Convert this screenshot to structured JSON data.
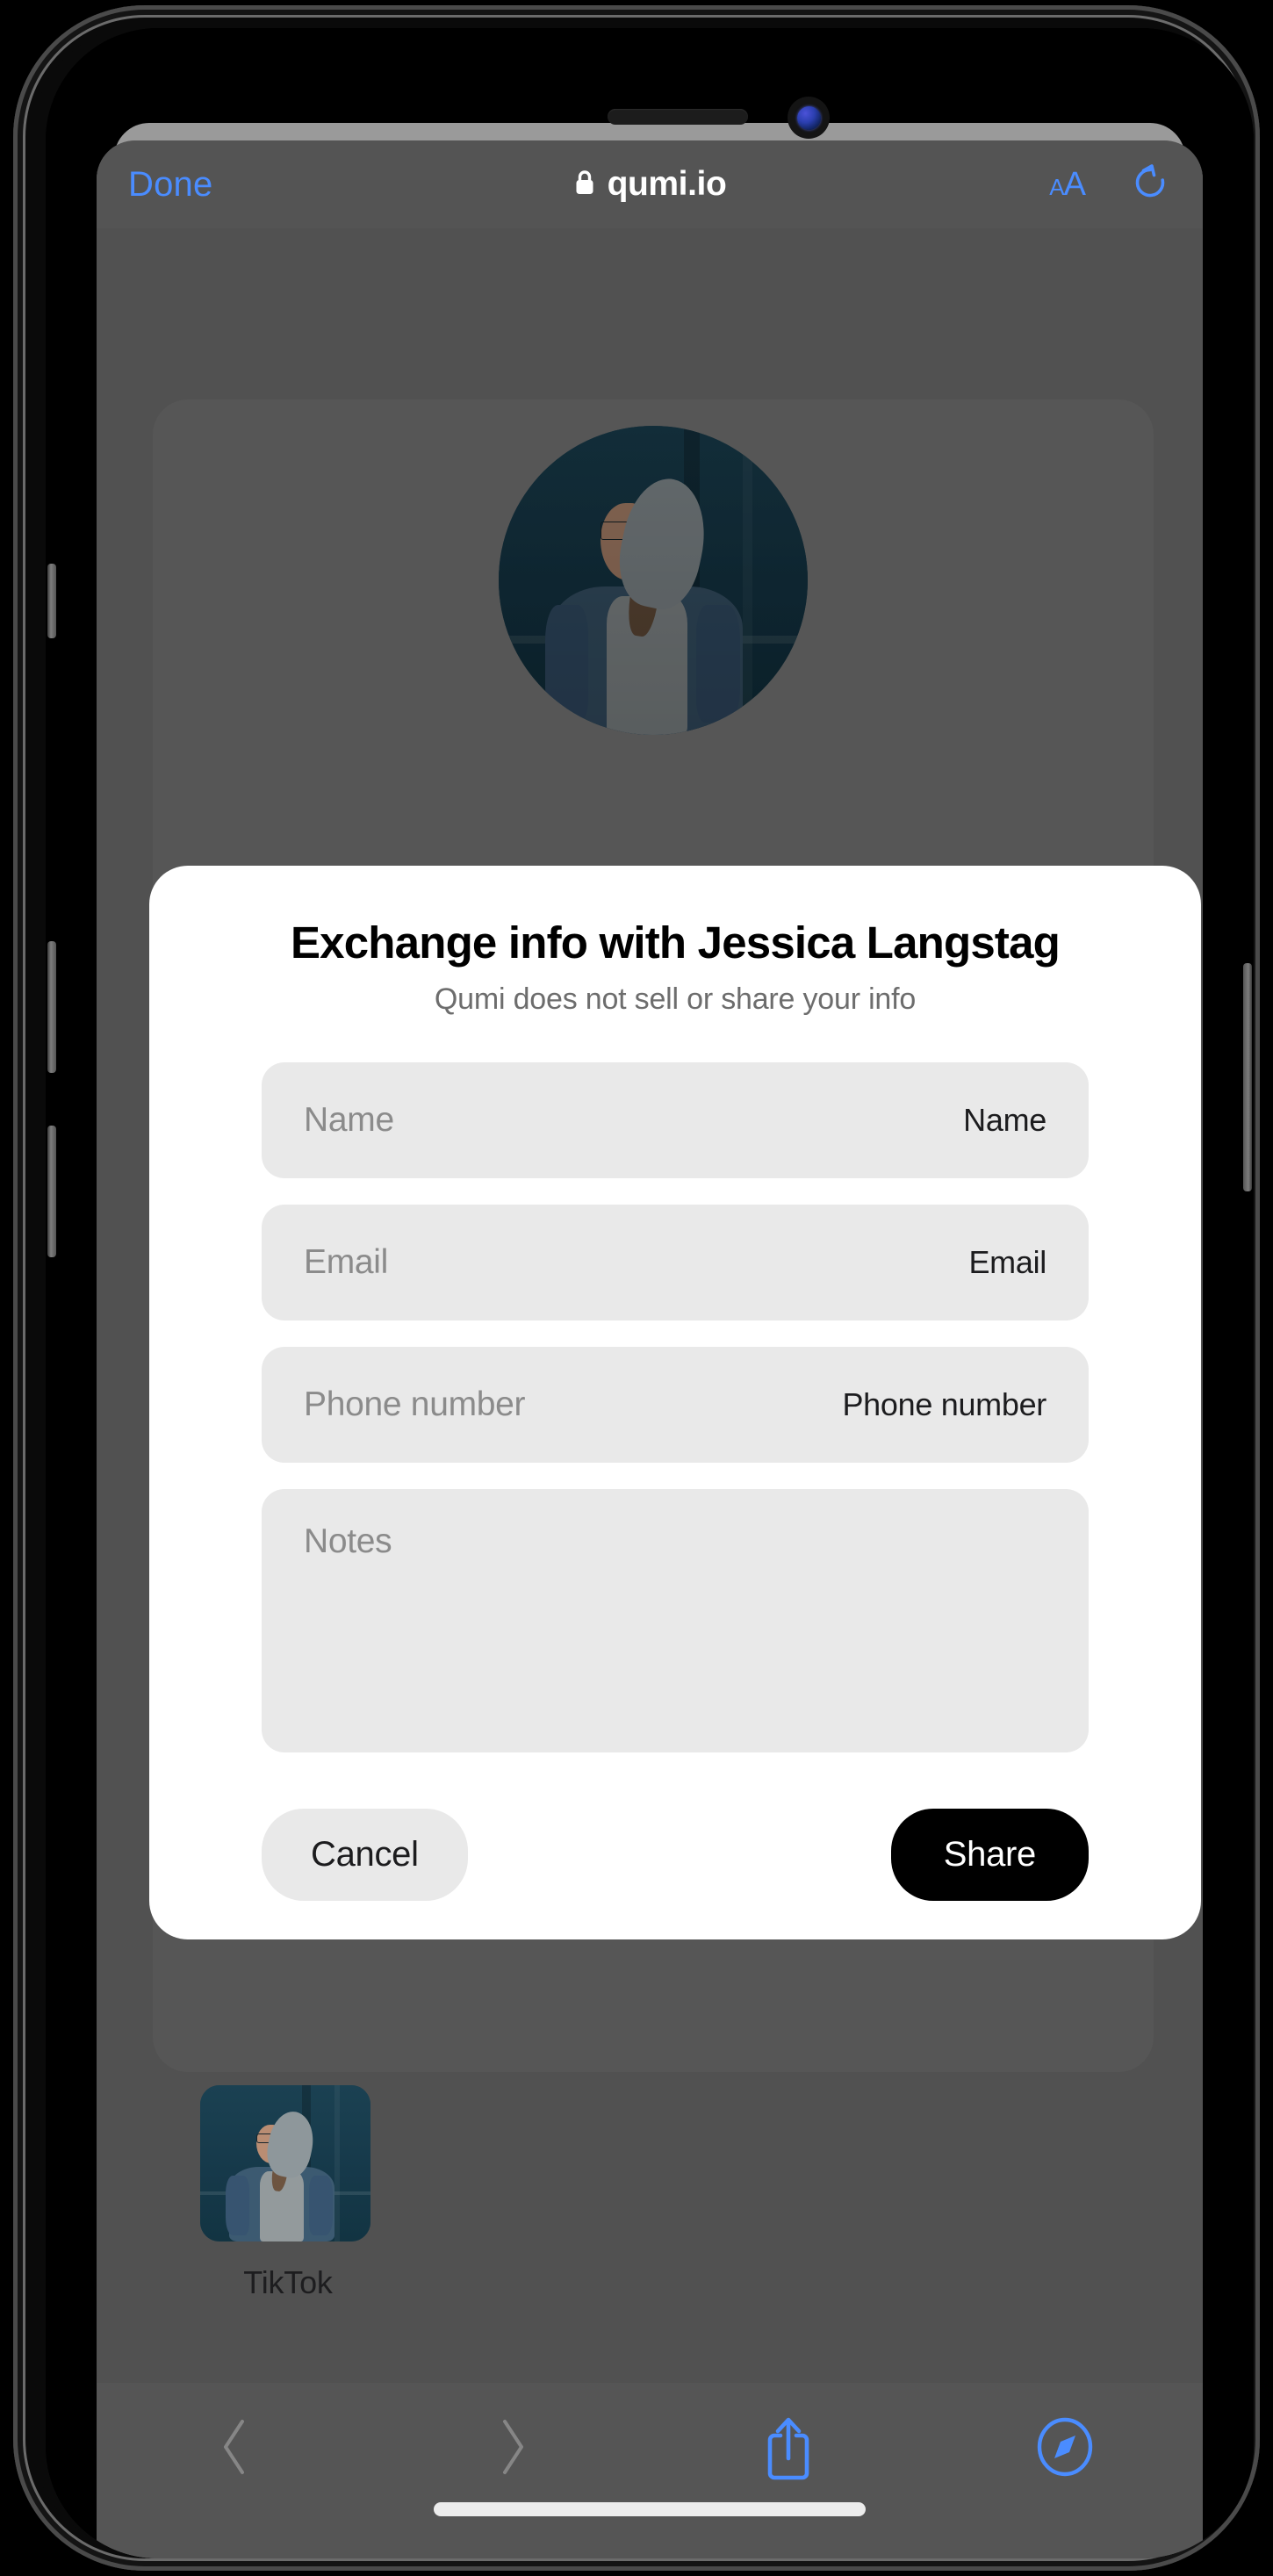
{
  "browser": {
    "done_label": "Done",
    "url": "qumi.io",
    "lock_icon": "lock-icon",
    "text_size_small": "A",
    "text_size_large": "A",
    "reload_icon": "reload-icon"
  },
  "toolbar": {
    "back_icon": "chevron-left-icon",
    "forward_icon": "chevron-right-icon",
    "share_icon": "share-icon",
    "safari_icon": "safari-compass-icon"
  },
  "page": {
    "avatar": "profile-avatar-photo",
    "link_tile": {
      "label": "TikTok",
      "thumbnail": "tiktok-thumbnail-photo"
    }
  },
  "modal": {
    "title": "Exchange info with Jessica Langstag",
    "subtitle": "Qumi does not sell or share your info",
    "fields": [
      {
        "placeholder": "Name",
        "label": "Name",
        "value": "",
        "type": "text"
      },
      {
        "placeholder": "Email",
        "label": "Email",
        "value": "",
        "type": "text"
      },
      {
        "placeholder": "Phone number",
        "label": "Phone number",
        "value": "",
        "type": "text"
      },
      {
        "placeholder": "Notes",
        "label": "",
        "value": "",
        "type": "textarea"
      }
    ],
    "cancel_label": "Cancel",
    "share_label": "Share"
  },
  "colors": {
    "accent_blue": "#4a8cff",
    "modal_bg": "#ffffff",
    "field_bg": "#e9e9e9",
    "share_bg": "#000000",
    "navbar_bg": "#545454",
    "page_bg": "#6e6e6e"
  }
}
